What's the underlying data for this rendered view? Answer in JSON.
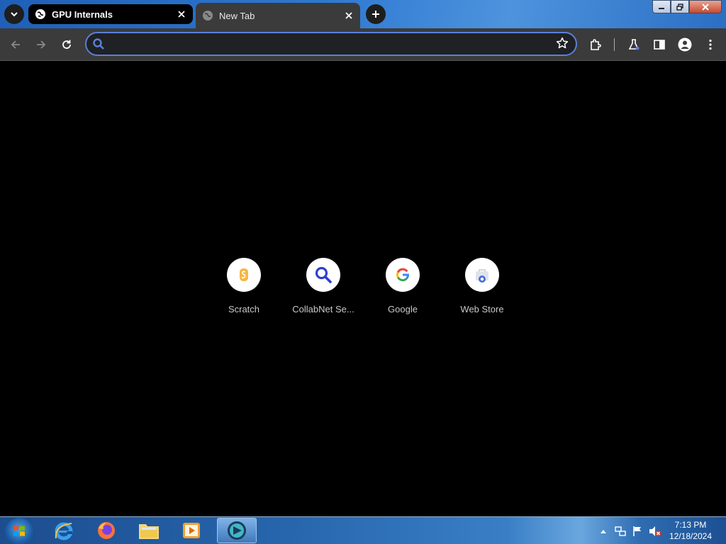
{
  "tabs": [
    {
      "title": "GPU Internals",
      "active": true
    },
    {
      "title": "New Tab",
      "active": false
    }
  ],
  "omnibox": {
    "value": "",
    "placeholder": ""
  },
  "shortcuts": [
    {
      "label": "Scratch",
      "icon": "scratch-icon"
    },
    {
      "label": "CollabNet Se...",
      "icon": "search-icon"
    },
    {
      "label": "Google",
      "icon": "google-icon"
    },
    {
      "label": "Web Store",
      "icon": "web-store-icon"
    }
  ],
  "taskbar": {
    "apps": [
      "internet-explorer-icon",
      "firefox-icon",
      "file-explorer-icon",
      "media-player-icon",
      "chromium-icon"
    ],
    "clock": {
      "time": "7:13 PM",
      "date": "12/18/2024"
    }
  },
  "colors": {
    "accent": "#5b7fd9",
    "tab_strip": "#2f79d1",
    "toolbar": "#3b3b3b"
  }
}
